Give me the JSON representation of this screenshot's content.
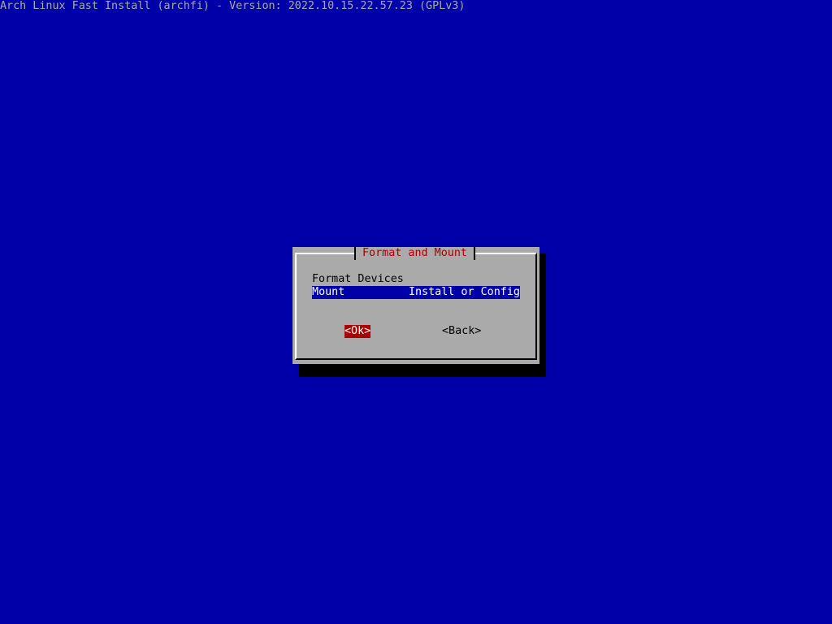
{
  "backtitle": "Arch Linux Fast Install (archfi) - Version: 2022.10.15.22.57.23 (GPLv3)",
  "dialog": {
    "title": "Format and Mount",
    "items": [
      {
        "tag": "Format Devices",
        "description": "",
        "selected": false
      },
      {
        "tag": "Mount",
        "description": "Install or Config",
        "selected": true
      }
    ],
    "ok_label": "<Ok>",
    "back_label": "<Back>"
  },
  "colors": {
    "background": "#0000a8",
    "dialog": "#aaaaaa",
    "title": "#a80000",
    "selection": "#0000a8",
    "active_button": "#a80000"
  }
}
